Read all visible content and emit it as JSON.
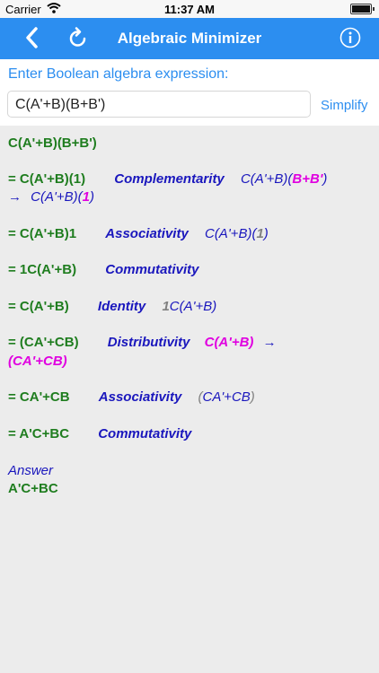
{
  "status": {
    "carrier": "Carrier",
    "time": "11:37 AM"
  },
  "nav": {
    "title": "Algebraic Minimizer"
  },
  "input": {
    "prompt": "Enter Boolean algebra expression:",
    "value": "C(A'+B)(B+B')",
    "simplify_label": "Simplify"
  },
  "steps": {
    "start": "C(A'+B)(B+B')",
    "s1": {
      "expr": "= C(A'+B)(1)",
      "rule": "Complementarity",
      "a": "C(A'+B)(",
      "b": "B",
      "c": "+",
      "d": "B'",
      "e": ")",
      "arrow": "→",
      "f": "C(A'+B)(",
      "g": "1",
      "h": ")"
    },
    "s2": {
      "expr": "= C(A'+B)1",
      "rule": "Associativity",
      "a": "C(A'+B)(",
      "b": "1",
      "c": ")"
    },
    "s3": {
      "expr": "= 1C(A'+B)",
      "rule": "Commutativity"
    },
    "s4": {
      "expr": "= C(A'+B)",
      "rule": "Identity",
      "a": "1",
      "b": "C(A'+B)"
    },
    "s5": {
      "expr": "= (CA'+CB)",
      "rule": "Distributivity",
      "a": "C(A'+B)",
      "arrow": "→",
      "b": "(CA'+CB)"
    },
    "s6": {
      "expr": "= CA'+CB",
      "rule": "Associativity",
      "a": "(",
      "b": "CA'+CB",
      "c": ")"
    },
    "s7": {
      "expr": "= A'C+BC",
      "rule": "Commutativity"
    },
    "answer_label": "Answer",
    "answer": "A'C+BC"
  }
}
